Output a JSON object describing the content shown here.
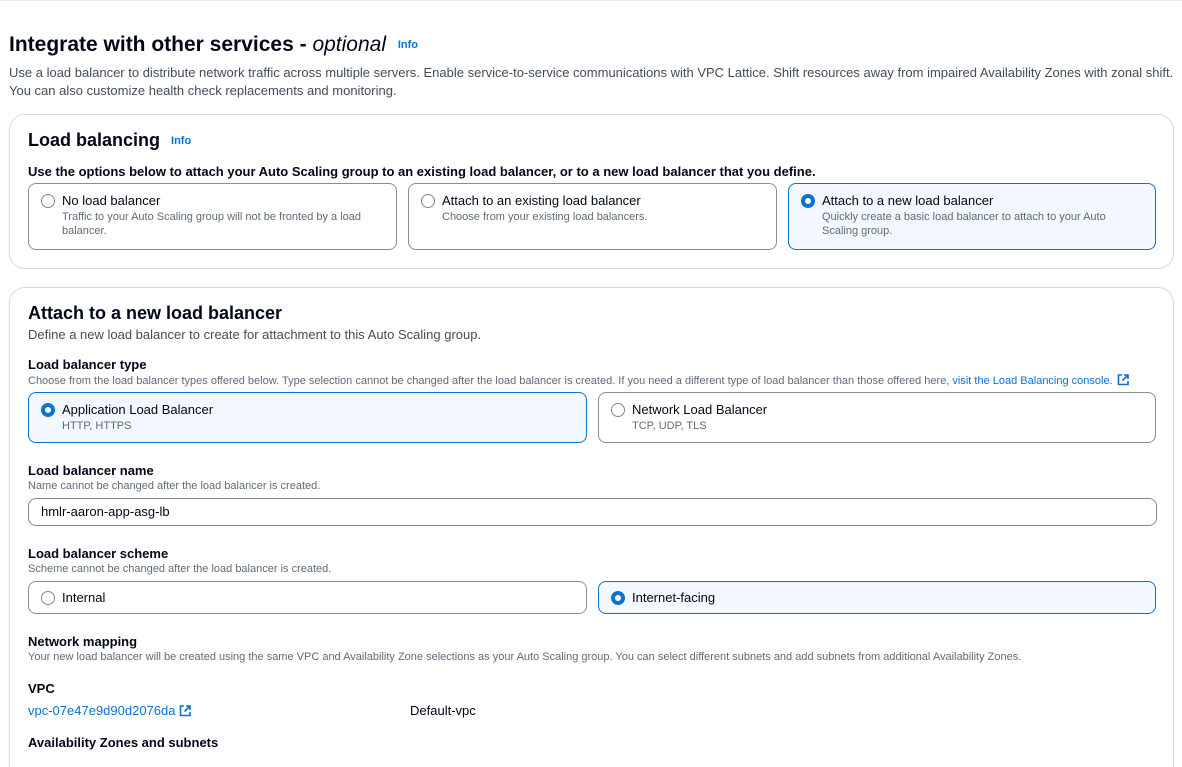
{
  "section": {
    "title": "Integrate with other services - ",
    "title_optional": "optional",
    "info": "Info",
    "description": "Use a load balancer to distribute network traffic across multiple servers. Enable service-to-service communications with VPC Lattice. Shift resources away from impaired Availability Zones with zonal shift. You can also customize health check replacements and monitoring."
  },
  "load_balancing": {
    "title": "Load balancing",
    "info": "Info",
    "instruction": "Use the options below to attach your Auto Scaling group to an existing load balancer, or to a new load balancer that you define.",
    "options": [
      {
        "title": "No load balancer",
        "description": "Traffic to your Auto Scaling group will not be fronted by a load balancer.",
        "selected": false
      },
      {
        "title": "Attach to an existing load balancer",
        "description": "Choose from your existing load balancers.",
        "selected": false
      },
      {
        "title": "Attach to a new load balancer",
        "description": "Quickly create a basic load balancer to attach to your Auto Scaling group.",
        "selected": true
      }
    ]
  },
  "new_lb": {
    "title": "Attach to a new load balancer",
    "description": "Define a new load balancer to create for attachment to this Auto Scaling group.",
    "type": {
      "label": "Load balancer type",
      "hint": "Choose from the load balancer types offered below. Type selection cannot be changed after the load balancer is created. If you need a different type of load balancer than those offered here, ",
      "hint_link": "visit the Load Balancing console.",
      "options": [
        {
          "title": "Application Load Balancer",
          "description": "HTTP, HTTPS",
          "selected": true
        },
        {
          "title": "Network Load Balancer",
          "description": "TCP, UDP, TLS",
          "selected": false
        }
      ]
    },
    "name": {
      "label": "Load balancer name",
      "hint": "Name cannot be changed after the load balancer is created.",
      "value": "hmlr-aaron-app-asg-lb"
    },
    "scheme": {
      "label": "Load balancer scheme",
      "hint": "Scheme cannot be changed after the load balancer is created.",
      "options": [
        {
          "title": "Internal",
          "selected": false
        },
        {
          "title": "Internet-facing",
          "selected": true
        }
      ]
    },
    "network": {
      "label": "Network mapping",
      "hint": "Your new load balancer will be created using the same VPC and Availability Zone selections as your Auto Scaling group. You can select different subnets and add subnets from additional Availability Zones."
    },
    "vpc": {
      "label": "VPC",
      "id": "vpc-07e47e9d90d2076da",
      "name": "Default-vpc"
    },
    "az": {
      "label": "Availability Zones and subnets"
    }
  },
  "colors": {
    "accent": "#0972d3",
    "selected_bg": "#f2f8fd",
    "border": "#8c8c94",
    "text": "#000716"
  }
}
